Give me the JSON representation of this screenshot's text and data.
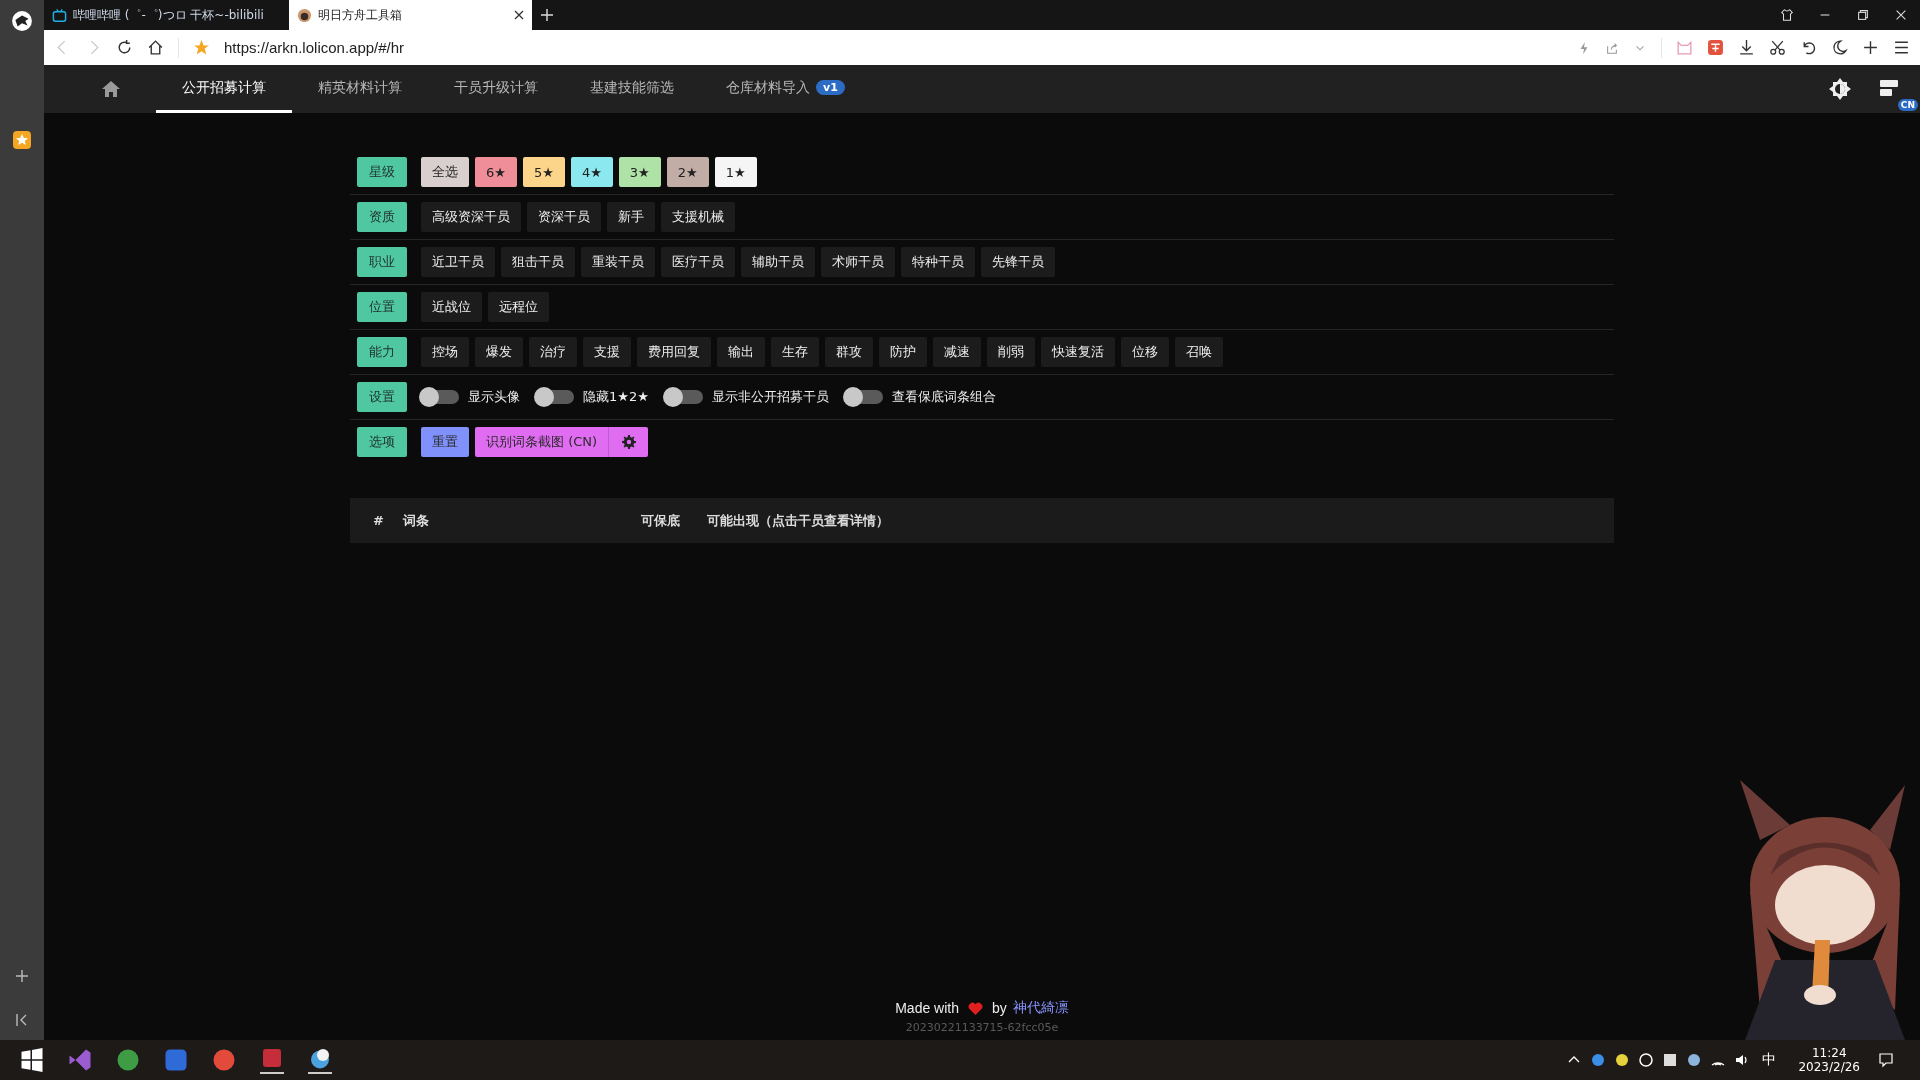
{
  "browser": {
    "tabs": [
      {
        "title": "哔哩哔哩 (゜-゜)つロ 干杯~-bilibili",
        "selected": false
      },
      {
        "title": "明日方舟工具箱",
        "selected": true
      }
    ],
    "url": "https://arkn.lolicon.app/#/hr"
  },
  "nav": {
    "items": [
      {
        "label": "公开招募计算",
        "selected": true
      },
      {
        "label": "精英材料计算",
        "selected": false
      },
      {
        "label": "干员升级计算",
        "selected": false
      },
      {
        "label": "基建技能筛选",
        "selected": false
      },
      {
        "label": "仓库材料导入",
        "selected": false,
        "badge": "v1"
      }
    ],
    "lang_badge": "CN"
  },
  "filters": [
    {
      "label": "星级",
      "kind": "chips",
      "items": [
        {
          "label": "全选",
          "color": "#d9cfcf"
        },
        {
          "label": "6★",
          "color": "#ef8d98"
        },
        {
          "label": "5★",
          "color": "#fcd48a"
        },
        {
          "label": "4★",
          "color": "#8be8ee"
        },
        {
          "label": "3★",
          "color": "#aee2a6"
        },
        {
          "label": "2★",
          "color": "#c2aca6"
        },
        {
          "label": "1★",
          "color": "#f5f5f5"
        }
      ]
    },
    {
      "label": "资质",
      "kind": "chips",
      "items": [
        {
          "label": "高级资深干员"
        },
        {
          "label": "资深干员"
        },
        {
          "label": "新手"
        },
        {
          "label": "支援机械"
        }
      ]
    },
    {
      "label": "职业",
      "kind": "chips",
      "items": [
        {
          "label": "近卫干员"
        },
        {
          "label": "狙击干员"
        },
        {
          "label": "重装干员"
        },
        {
          "label": "医疗干员"
        },
        {
          "label": "辅助干员"
        },
        {
          "label": "术师干员"
        },
        {
          "label": "特种干员"
        },
        {
          "label": "先锋干员"
        }
      ]
    },
    {
      "label": "位置",
      "kind": "chips",
      "items": [
        {
          "label": "近战位"
        },
        {
          "label": "远程位"
        }
      ]
    },
    {
      "label": "能力",
      "kind": "chips",
      "items": [
        {
          "label": "控场"
        },
        {
          "label": "爆发"
        },
        {
          "label": "治疗"
        },
        {
          "label": "支援"
        },
        {
          "label": "费用回复"
        },
        {
          "label": "输出"
        },
        {
          "label": "生存"
        },
        {
          "label": "群攻"
        },
        {
          "label": "防护"
        },
        {
          "label": "减速"
        },
        {
          "label": "削弱"
        },
        {
          "label": "快速复活"
        },
        {
          "label": "位移"
        },
        {
          "label": "召唤"
        }
      ]
    },
    {
      "label": "设置",
      "kind": "toggles",
      "items": [
        {
          "label": "显示头像",
          "on": false
        },
        {
          "label": "隐藏1★2★",
          "on": false
        },
        {
          "label": "显示非公开招募干员",
          "on": false
        },
        {
          "label": "查看保底词条组合",
          "on": false
        }
      ]
    },
    {
      "label": "选项",
      "kind": "actions",
      "items": [
        {
          "label": "重置",
          "color": "#8091fb"
        },
        {
          "label": "识别词条截图 (CN)",
          "color": "#e06cf2"
        }
      ]
    }
  ],
  "table": {
    "columns": [
      "#",
      "词条",
      "可保底",
      "可能出现（点击干员查看详情）"
    ]
  },
  "footer": {
    "made_with": "Made with",
    "by": "by",
    "author": "神代綺凛",
    "version": "20230221133715-62fcc05e"
  },
  "taskbar": {
    "ime": "中",
    "time": "11:24",
    "date": "2023/2/26"
  }
}
